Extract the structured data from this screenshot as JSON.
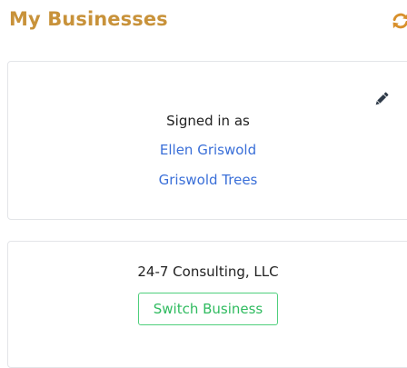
{
  "header": {
    "title": "My Businesses",
    "refresh_icon": "refresh-icon"
  },
  "signed_in_card": {
    "edit_icon": "pencil-icon",
    "label": "Signed in as",
    "user_name": "Ellen Griswold",
    "company_name": "Griswold Trees"
  },
  "business_card": {
    "business_name": "24-7 Consulting, LLC",
    "switch_label": "Switch Business"
  },
  "colors": {
    "title": "#c8923a",
    "link": "#3a6fd8",
    "switch": "#2fbb5f",
    "icon": "#d8902c",
    "edit_icon": "#2e3a48"
  }
}
